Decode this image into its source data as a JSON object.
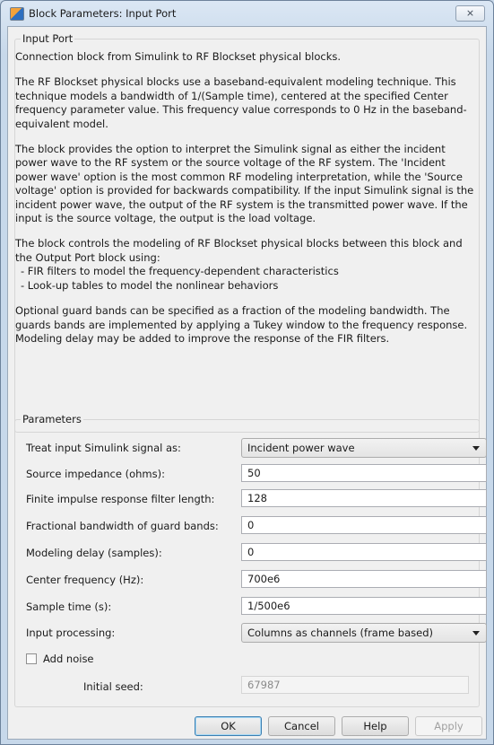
{
  "window": {
    "title": "Block Parameters: Input Port",
    "close_label": "⨯"
  },
  "input_port": {
    "legend": "Input Port",
    "p1": "Connection block from Simulink to RF Blockset physical blocks.",
    "p2": "The RF Blockset physical blocks use a baseband-equivalent modeling technique. This technique models a bandwidth of 1/(Sample time), centered at the specified Center frequency parameter value. This frequency value corresponds to 0 Hz in the baseband-equivalent model.",
    "p3": "The block provides the option to interpret the Simulink signal as either the incident power wave to the RF system or the source voltage of the RF system. The 'Incident power wave' option is the most common RF modeling interpretation, while the 'Source voltage' option is provided for backwards compatibility. If the input Simulink signal is the incident power wave, the output of the RF system is the transmitted power wave. If the input is the source voltage, the output is the load voltage.",
    "p4_intro": "The block controls the modeling of RF Blockset physical blocks between this block and the Output Port block using:",
    "p4_bullet1": "- FIR filters to model the frequency-dependent characteristics",
    "p4_bullet2": "- Look-up tables to model the nonlinear behaviors",
    "p5": "Optional guard bands can be specified as a fraction of the modeling bandwidth. The guards bands are implemented by applying a Tukey window to the frequency response. Modeling delay may be added to improve the response of the FIR filters."
  },
  "parameters": {
    "legend": "Parameters",
    "treat_label": "Treat input Simulink signal as:",
    "treat_value": "Incident power wave",
    "source_impedance_label": "Source impedance (ohms):",
    "source_impedance_value": "50",
    "fir_length_label": "Finite impulse response filter length:",
    "fir_length_value": "128",
    "guard_bands_label": "Fractional bandwidth of guard bands:",
    "guard_bands_value": "0",
    "delay_label": "Modeling delay (samples):",
    "delay_value": "0",
    "center_freq_label": "Center frequency (Hz):",
    "center_freq_value": "700e6",
    "sample_time_label": "Sample time (s):",
    "sample_time_value": "1/500e6",
    "input_processing_label": "Input processing:",
    "input_processing_value": "Columns as channels (frame based)",
    "add_noise_label": "Add noise",
    "add_noise_checked": false,
    "initial_seed_label": "Initial seed:",
    "initial_seed_value": "67987"
  },
  "buttons": {
    "ok": "OK",
    "cancel": "Cancel",
    "help": "Help",
    "apply": "Apply"
  }
}
